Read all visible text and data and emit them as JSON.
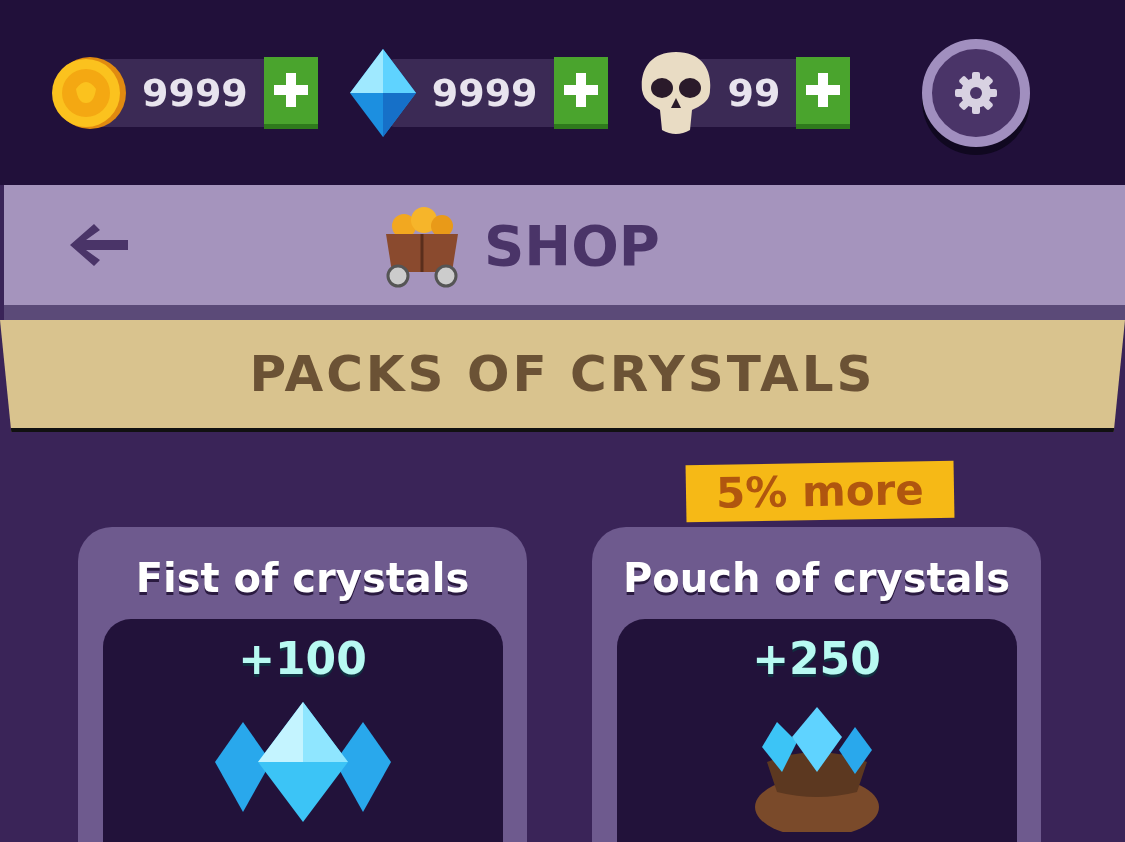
{
  "currencies": [
    {
      "kind": "coin",
      "amount": "9999"
    },
    {
      "kind": "gem",
      "amount": "9999"
    },
    {
      "kind": "skull",
      "amount": "99"
    }
  ],
  "header": {
    "title": "SHOP"
  },
  "section": {
    "title": "PACKS OF CRYSTALS"
  },
  "packs": [
    {
      "kind": "gems",
      "name": "Fist of crystals",
      "amount": "+100"
    },
    {
      "kind": "bag",
      "name": "Pouch of crystals",
      "amount": "+250",
      "badge": "5% more"
    }
  ]
}
